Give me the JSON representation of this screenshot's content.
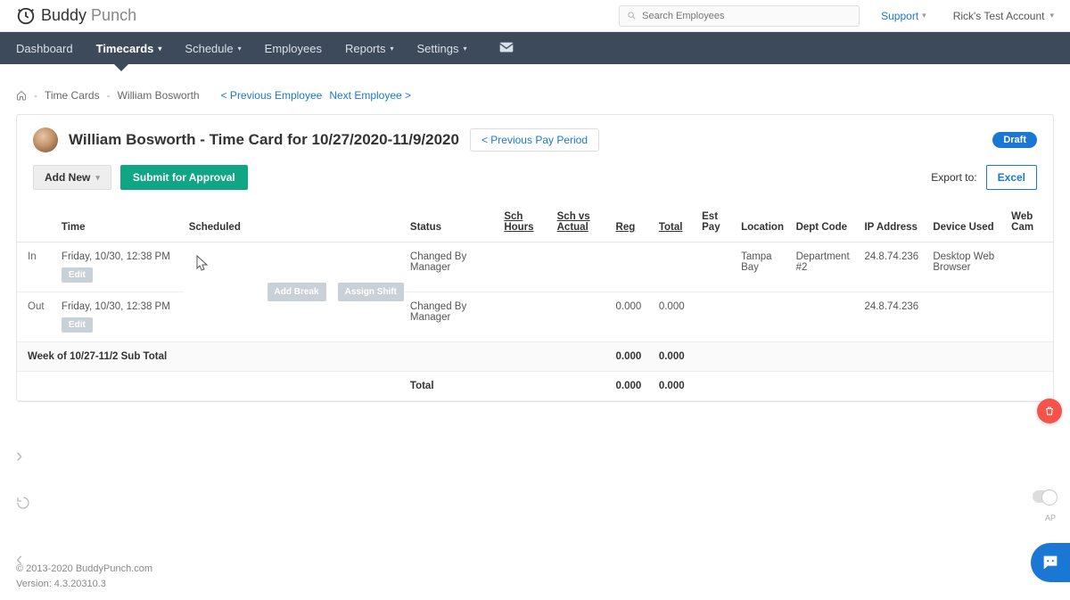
{
  "brand": {
    "name1": "Buddy",
    "name2": " Punch"
  },
  "search": {
    "placeholder": "Search Employees"
  },
  "support_label": "Support",
  "account_label": "Rick's Test Account",
  "nav": {
    "dashboard": "Dashboard",
    "timecards": "Timecards",
    "schedule": "Schedule",
    "employees": "Employees",
    "reports": "Reports",
    "settings": "Settings"
  },
  "crumbs": {
    "root_sep": " - ",
    "timecards": "Time Cards",
    "sep2": " - ",
    "employee": "William Bosworth",
    "prev_emp": "< Previous Employee",
    "next_emp": "Next Employee >"
  },
  "card": {
    "title": "William Bosworth - Time Card for 10/27/2020-11/9/2020",
    "prev_period": "< Previous Pay Period",
    "draft": "Draft",
    "add_new": "Add New",
    "submit": "Submit for Approval",
    "export_label": "Export to:",
    "excel": "Excel"
  },
  "headers": {
    "time": "Time",
    "scheduled": "Scheduled",
    "status": "Status",
    "sch_hours": "Sch Hours",
    "sch_vs_actual": "Sch vs Actual",
    "reg": "Reg",
    "total": "Total",
    "est_pay": "Est Pay",
    "location": "Location",
    "dept_code": "Dept Code",
    "ip": "IP Address",
    "device": "Device Used",
    "webcam": "Web Cam"
  },
  "rows": {
    "in_label": "In",
    "out_label": "Out",
    "in_time": "Friday, 10/30, 12:38 PM",
    "out_time": "Friday, 10/30, 12:38 PM",
    "edit": "Edit",
    "add_break": "Add Break",
    "assign_shift": "Assign Shift",
    "status_in": "Changed By Manager",
    "status_out": "Changed By Manager",
    "reg_out": "0.000",
    "total_out": "0.000",
    "location_in": "Tampa Bay",
    "dept_in": "Department #2",
    "ip_in": "24.8.74.236",
    "ip_out": "24.8.74.236",
    "device_in": "Desktop Web Browser"
  },
  "subtotal": {
    "label": "Week of 10/27-11/2 Sub Total",
    "reg": "0.000",
    "total": "0.000"
  },
  "grand": {
    "label": "Total",
    "reg": "0.000",
    "total": "0.000"
  },
  "footer": {
    "copyright": "© 2013-2020 BuddyPunch.com",
    "version": "Version: 4.3.20310.3"
  },
  "ap": "AP"
}
